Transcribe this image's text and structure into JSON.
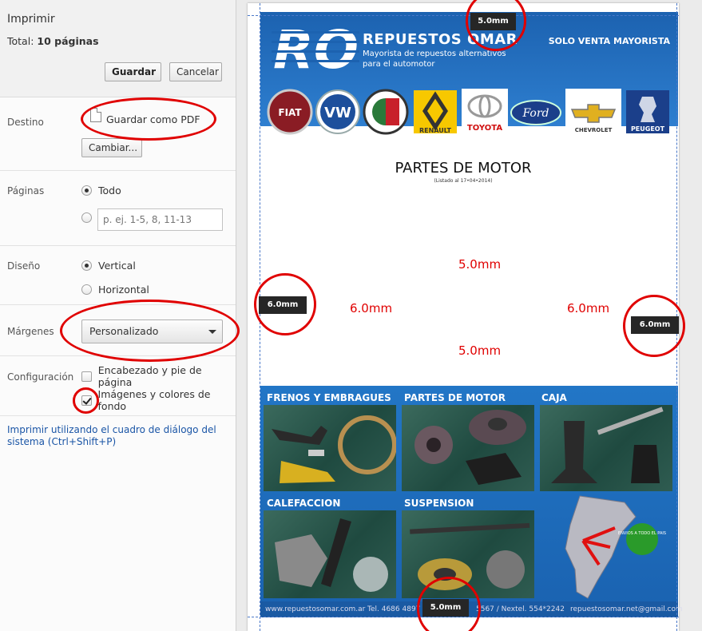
{
  "dialog": {
    "title": "Imprimir",
    "total_label": "Total:",
    "total_value": "10 páginas",
    "save_label": "Guardar",
    "cancel_label": "Cancelar"
  },
  "destination": {
    "label": "Destino",
    "value": "Guardar como PDF",
    "change_label": "Cambiar..."
  },
  "pages": {
    "label": "Páginas",
    "all_label": "Todo",
    "range_placeholder": "p. ej. 1-5, 8, 11-13",
    "selected": "all"
  },
  "layout": {
    "label": "Diseño",
    "portrait_label": "Vertical",
    "landscape_label": "Horizontal",
    "selected": "portrait"
  },
  "margins": {
    "label": "Márgenes",
    "value": "Personalizado"
  },
  "options": {
    "label": "Configuración",
    "headers_label": "Encabezado y pie de página",
    "headers_checked": false,
    "backgrounds_label": "Imágenes y colores de fondo",
    "backgrounds_checked": true
  },
  "system_dialog_link": "Imprimir utilizando el cuadro de diálogo del sistema (Ctrl+Shift+P)",
  "preview": {
    "margin_top": "5.0mm",
    "margin_bottom": "5.0mm",
    "margin_left": "6.0mm",
    "margin_right": "6.0mm",
    "page": {
      "logo_text": "RO",
      "brand_name": "REPUESTOS OMAR",
      "brand_tagline": "Mayorista de repuestos alternativos para el automotor",
      "wholesale_only": "SOLO VENTA MAYORISTA",
      "car_brands": [
        "FIAT",
        "VW",
        "ALFA ROMEO",
        "RENAULT",
        "TOYOTA",
        "Ford",
        "CHEVROLET",
        "PEUGEOT"
      ],
      "title": "PARTES DE MOTOR",
      "subtitle": "(Listado al 17•04•2014)",
      "categories": [
        "FRENOS Y EMBRAGUES",
        "PARTES DE MOTOR",
        "CAJA",
        "CALEFACCION",
        "SUSPENSION"
      ],
      "shipping_badge": "ENVIOS A TODO EL PAIS",
      "footer_web": "www.repuestosomar.com.ar",
      "footer_phone": "Tel. 4686 4897",
      "footer_nextel": "5567 / Nextel. 554*2242",
      "footer_email": "repuestosomar.net@gmail.com"
    }
  },
  "colors": {
    "annotation_red": "#e00000",
    "brand_blue": "#1c62b0",
    "link_blue": "#1a55a6"
  }
}
